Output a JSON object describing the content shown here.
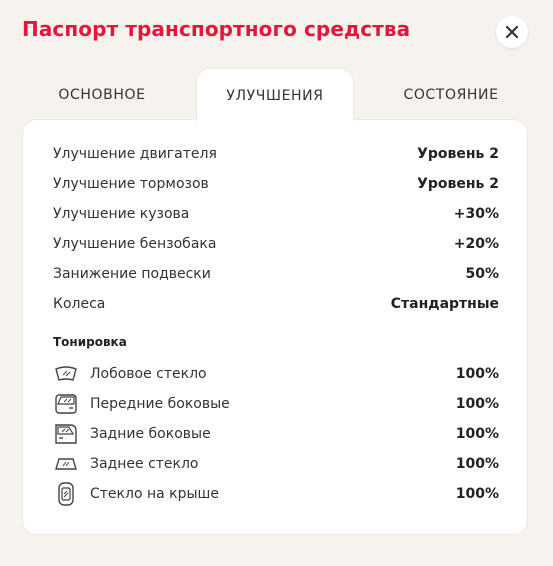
{
  "title": "Паспорт транспортного средства",
  "tabs": [
    {
      "label": "ОСНОВНОЕ",
      "active": false
    },
    {
      "label": "УЛУЧШЕНИЯ",
      "active": true
    },
    {
      "label": "СОСТОЯНИЕ",
      "active": false
    }
  ],
  "upgrades": [
    {
      "label": "Улучшение двигателя",
      "value": "Уровень 2"
    },
    {
      "label": "Улучшение тормозов",
      "value": "Уровень 2"
    },
    {
      "label": "Улучшение кузова",
      "value": "+30%"
    },
    {
      "label": "Улучшение бензобака",
      "value": "+20%"
    },
    {
      "label": "Занижение подвески",
      "value": "50%"
    },
    {
      "label": "Колеса",
      "value": "Стандартные"
    }
  ],
  "tinting": {
    "title": "Тонировка",
    "items": [
      {
        "label": "Лобовое стекло",
        "value": "100%",
        "icon": "windshield-icon"
      },
      {
        "label": "Передние боковые",
        "value": "100%",
        "icon": "front-side-window-icon"
      },
      {
        "label": "Задние боковые",
        "value": "100%",
        "icon": "rear-side-window-icon"
      },
      {
        "label": "Заднее стекло",
        "value": "100%",
        "icon": "rear-window-icon"
      },
      {
        "label": "Стекло на крыше",
        "value": "100%",
        "icon": "roof-glass-icon"
      }
    ]
  },
  "colors": {
    "accent": "#e6153a",
    "text": "#333333"
  }
}
